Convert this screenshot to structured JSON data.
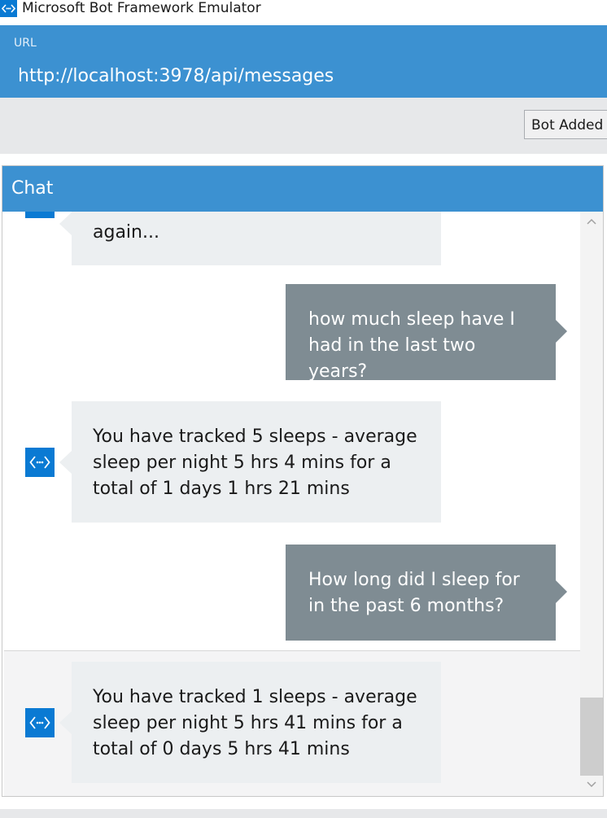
{
  "window": {
    "title": "Microsoft Bot Framework Emulator",
    "app_icon": "bot-emulator-icon",
    "accent_color": "#3c91d1"
  },
  "address": {
    "label": "URL",
    "value": "http://localhost:3978/api/messages"
  },
  "toolbar": {
    "status_button_label": "Bot Added T"
  },
  "chat": {
    "title": "Chat",
    "messages": [
      {
        "from": "bot",
        "text": "again..."
      },
      {
        "from": "user",
        "text": "how much sleep have I had in the last two years?"
      },
      {
        "from": "bot",
        "text": "You have tracked 5 sleeps - average sleep per night 5 hrs 4 mins for a total of 1 days 1 hrs 21 mins"
      },
      {
        "from": "user",
        "text": "How long did I sleep for in the past 6 months?"
      },
      {
        "from": "bot",
        "text": "You have tracked 1 sleeps - average sleep per night 5 hrs 41 mins for a total of 0 days 5 hrs 41 mins"
      }
    ],
    "bot_bubble_color": "#eceff1",
    "user_bubble_color": "#7f8c93"
  },
  "scrollbar": {
    "up_icon": "chevron-up-icon",
    "down_icon": "chevron-down-icon"
  }
}
